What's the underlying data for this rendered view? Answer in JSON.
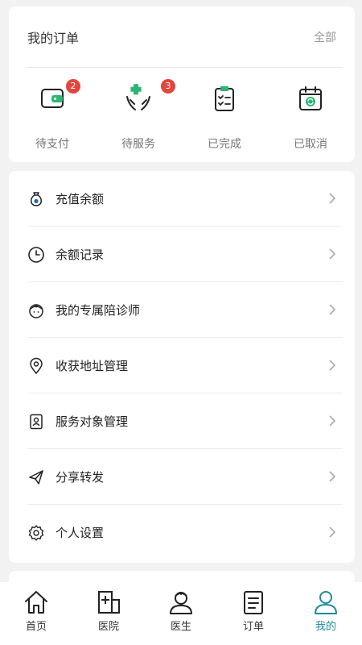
{
  "orders": {
    "title": "我的订单",
    "all_label": "全部",
    "items": [
      {
        "label": "待支付",
        "badge": "2",
        "icon": "wallet-icon"
      },
      {
        "label": "待服务",
        "badge": "3",
        "icon": "care-hands-icon"
      },
      {
        "label": "已完成",
        "badge": "",
        "icon": "clipboard-check-icon"
      },
      {
        "label": "已取消",
        "badge": "",
        "icon": "calendar-refresh-icon"
      }
    ]
  },
  "menu": {
    "items": [
      {
        "label": "充值余额",
        "icon": "money-bag-icon"
      },
      {
        "label": "余额记录",
        "icon": "clock-icon"
      },
      {
        "label": "我的专属陪诊师",
        "icon": "nurse-icon"
      },
      {
        "label": "收获地址管理",
        "icon": "location-pin-icon"
      },
      {
        "label": "服务对象管理",
        "icon": "person-card-icon"
      },
      {
        "label": "分享转发",
        "icon": "paper-plane-icon"
      },
      {
        "label": "个人设置",
        "icon": "settings-gear-icon"
      }
    ]
  },
  "tabbar": {
    "items": [
      {
        "label": "首页",
        "icon": "home-icon"
      },
      {
        "label": "医院",
        "icon": "hospital-icon"
      },
      {
        "label": "医生",
        "icon": "doctor-icon"
      },
      {
        "label": "订单",
        "icon": "order-list-icon"
      },
      {
        "label": "我的",
        "icon": "user-icon"
      }
    ],
    "active_index": 4
  },
  "colors": {
    "accent": "#1d8aa0",
    "icon_green": "#2bb673",
    "badge": "#e2463d",
    "background": "#f2f2f2"
  }
}
